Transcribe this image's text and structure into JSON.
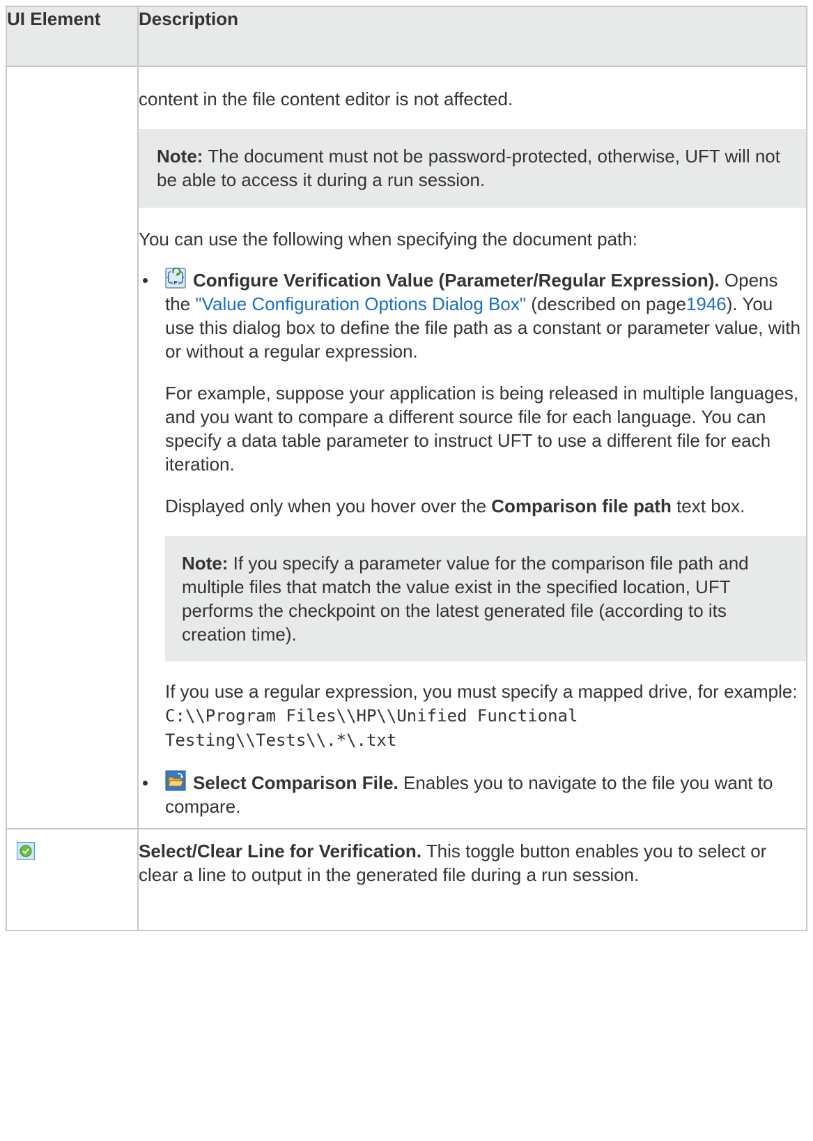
{
  "table": {
    "header": {
      "col1": "UI Element",
      "col2": "Description"
    },
    "row1": {
      "continuation": "content in the file content editor is not affected.",
      "note1": {
        "label": "Note:",
        "text": " The document must not be password-protected, otherwise, UFT will not be able to access it during a run session."
      },
      "intro": "You can use the following when specifying the document path:",
      "item1": {
        "icon": "parameter-icon",
        "title": "Configure Verification Value (Parameter/Regular Expression).",
        "text_before_link": " Opens the ",
        "link": "\"Value Configuration Options Dialog Box\"",
        "text_described": " (described on page",
        "page_ref": "1946",
        "text_after": "). You use this dialog box to define the file path as a constant or parameter value, with or without a regular expression.",
        "example": "For example, suppose your application is being released in multiple languages, and you want to compare a different source file for each language. You can specify a data table parameter to instruct UFT to use a different file for each iteration.",
        "displayed_prefix": "Displayed only when you hover over the ",
        "displayed_bold": "Comparison file path",
        "displayed_suffix": " text box.",
        "note2": {
          "label": "Note:",
          "text": " If you specify a parameter value for the comparison file path and multiple files that match the value exist in the specified location, UFT performs the checkpoint on the latest generated file (according to its creation time)."
        },
        "regex_text": "If you use a regular expression, you must specify a mapped drive, for example: ",
        "regex_code": "C:\\\\Program Files\\\\HP\\\\Unified Functional Testing\\\\Tests\\\\.*\\.txt"
      },
      "item2": {
        "icon": "folder-open-icon",
        "title": "Select Comparison File.",
        "text": " Enables you to navigate to the file you want to compare."
      }
    },
    "row2": {
      "icon": "check-circle-icon",
      "title": "Select/Clear Line for Verification.",
      "text": " This toggle button enables you to select or clear a line to output in the generated file during a run session."
    }
  },
  "colors": {
    "border": "#c6c8c8",
    "header_bg": "#e8eaea",
    "note_bg": "#e8eaea",
    "link": "#1a6fc4",
    "text": "#333333"
  }
}
